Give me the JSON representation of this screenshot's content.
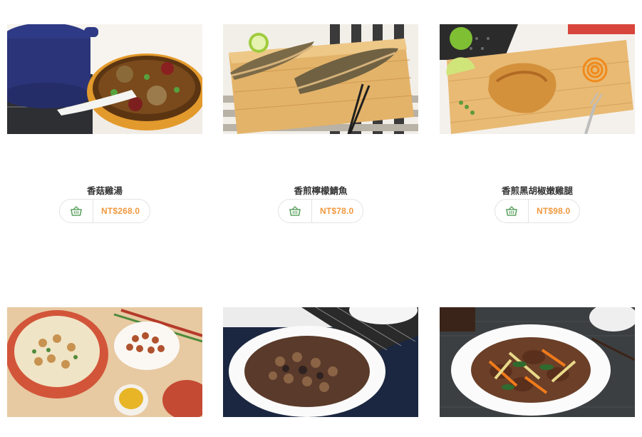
{
  "products": [
    {
      "name": "香菇雞湯",
      "price": "NT$268.0",
      "image": "mushroom-chicken-soup"
    },
    {
      "name": "香煎檸檬鯖魚",
      "price": "NT$78.0",
      "image": "pan-fried-lemon-mackerel"
    },
    {
      "name": "香煎黑胡椒嫩雞腿",
      "price": "NT$98.0",
      "image": "black-pepper-chicken-leg"
    },
    {
      "name": "",
      "price": "",
      "image": "peanut-anchovy-dish"
    },
    {
      "name": "",
      "price": "",
      "image": "braised-pork-sauce"
    },
    {
      "name": "",
      "price": "",
      "image": "stir-fried-beef-vegetables"
    }
  ],
  "icons": {
    "cart": "shopping-basket-icon"
  },
  "colors": {
    "price": "#f0993f",
    "cart_icon": "#5fa463",
    "border": "#e3e3e3"
  }
}
